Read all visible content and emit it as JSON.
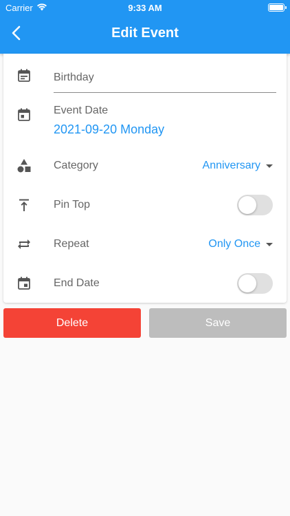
{
  "status_bar": {
    "carrier": "Carrier",
    "time": "9:33 AM"
  },
  "header": {
    "title": "Edit Event"
  },
  "form": {
    "title_field": {
      "value": "",
      "placeholder": "Birthday"
    },
    "event_date": {
      "label": "Event Date",
      "value": "2021-09-20 Monday"
    },
    "category": {
      "label": "Category",
      "value": "Anniversary"
    },
    "pin_top": {
      "label": "Pin Top",
      "enabled": false
    },
    "repeat": {
      "label": "Repeat",
      "value": "Only Once"
    },
    "end_date": {
      "label": "End Date",
      "enabled": false
    }
  },
  "actions": {
    "delete_label": "Delete",
    "save_label": "Save"
  },
  "colors": {
    "primary": "#2196f3",
    "danger": "#f44336",
    "disabled": "#bdbdbd"
  },
  "icons": [
    "wifi-icon",
    "battery-icon",
    "back-arrow-icon",
    "calendar-icon",
    "calendar-event-icon",
    "category-shapes-icon",
    "pin-top-icon",
    "repeat-icon",
    "end-date-icon",
    "caret-down-icon"
  ]
}
